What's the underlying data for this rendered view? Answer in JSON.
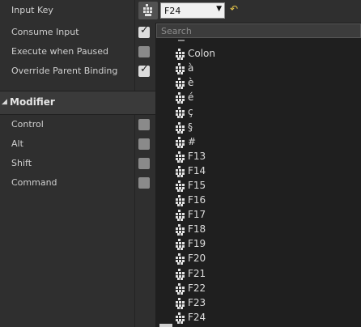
{
  "properties": [
    {
      "label": "Input Key",
      "checked": null
    },
    {
      "label": "Consume Input",
      "checked": true
    },
    {
      "label": "Execute when Paused",
      "checked": false
    },
    {
      "label": "Override Parent Binding",
      "checked": true
    }
  ],
  "modifier": {
    "title": "Modifier",
    "items": [
      {
        "label": "Control",
        "checked": false
      },
      {
        "label": "Alt",
        "checked": false
      },
      {
        "label": "Shift",
        "checked": false
      },
      {
        "label": "Command",
        "checked": false
      }
    ]
  },
  "key_selector": {
    "selected": "F24",
    "reset_symbol": "↶"
  },
  "search": {
    "placeholder": "Search",
    "value": ""
  },
  "keys": [
    "Colon",
    "à",
    "è",
    "é",
    "ç",
    "§",
    "#",
    "F13",
    "F14",
    "F15",
    "F16",
    "F17",
    "F18",
    "F19",
    "F20",
    "F21",
    "F22",
    "F23",
    "F24"
  ],
  "colors": {
    "accent_reset": "#e8c84a",
    "checkbox_on": "#dcdcdc",
    "checkbox_off": "#8a8a8a"
  }
}
